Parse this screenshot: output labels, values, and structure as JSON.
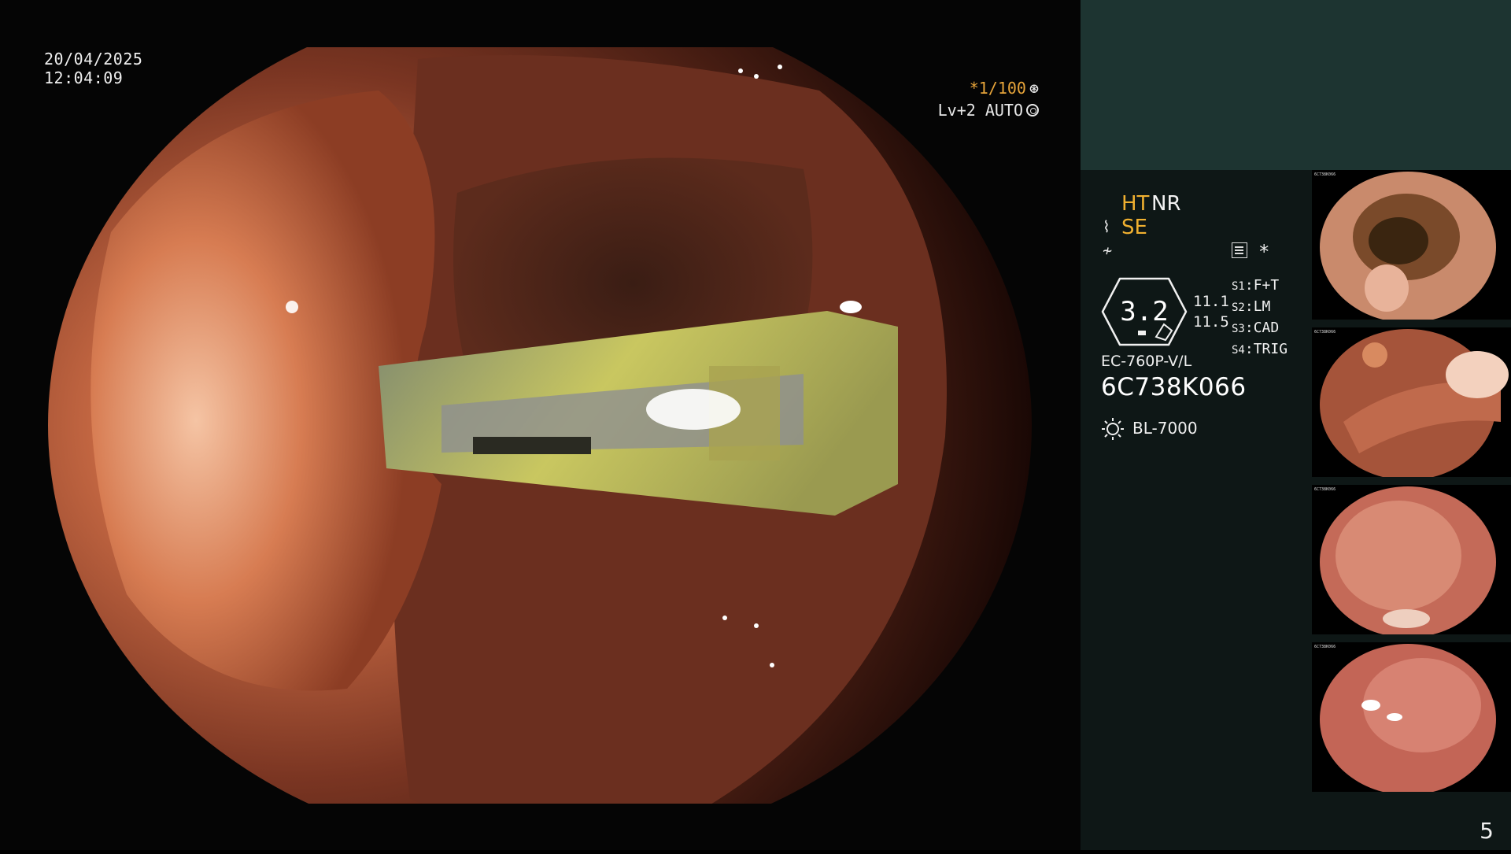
{
  "main": {
    "date": "20/04/2025",
    "time": "12:04:09",
    "shutter": "*1/100",
    "level": "Lv+2 AUTO"
  },
  "panel": {
    "modes": {
      "ht": "HT",
      "nr": "NR",
      "se": "SE"
    },
    "hex_value": "3.2",
    "num_a": "11.1",
    "num_b": "11.5",
    "switches": [
      {
        "key": "S1",
        "value": "F+T"
      },
      {
        "key": "S2",
        "value": "LM"
      },
      {
        "key": "S3",
        "value": "CAD"
      },
      {
        "key": "S4",
        "value": "TRIG"
      }
    ],
    "model": "EC-760P-V/L",
    "serial": "6C738K066",
    "light_source": "BL-7000",
    "page": "5"
  },
  "thumbnails": [
    {
      "label": "6C738K066"
    },
    {
      "label": "6C738K066"
    },
    {
      "label": "6C738K066"
    },
    {
      "label": "6C738K066"
    }
  ],
  "colors": {
    "panel_top": "#1d3431",
    "panel_bg": "#0e1716",
    "accent_orange": "#f0b030"
  }
}
